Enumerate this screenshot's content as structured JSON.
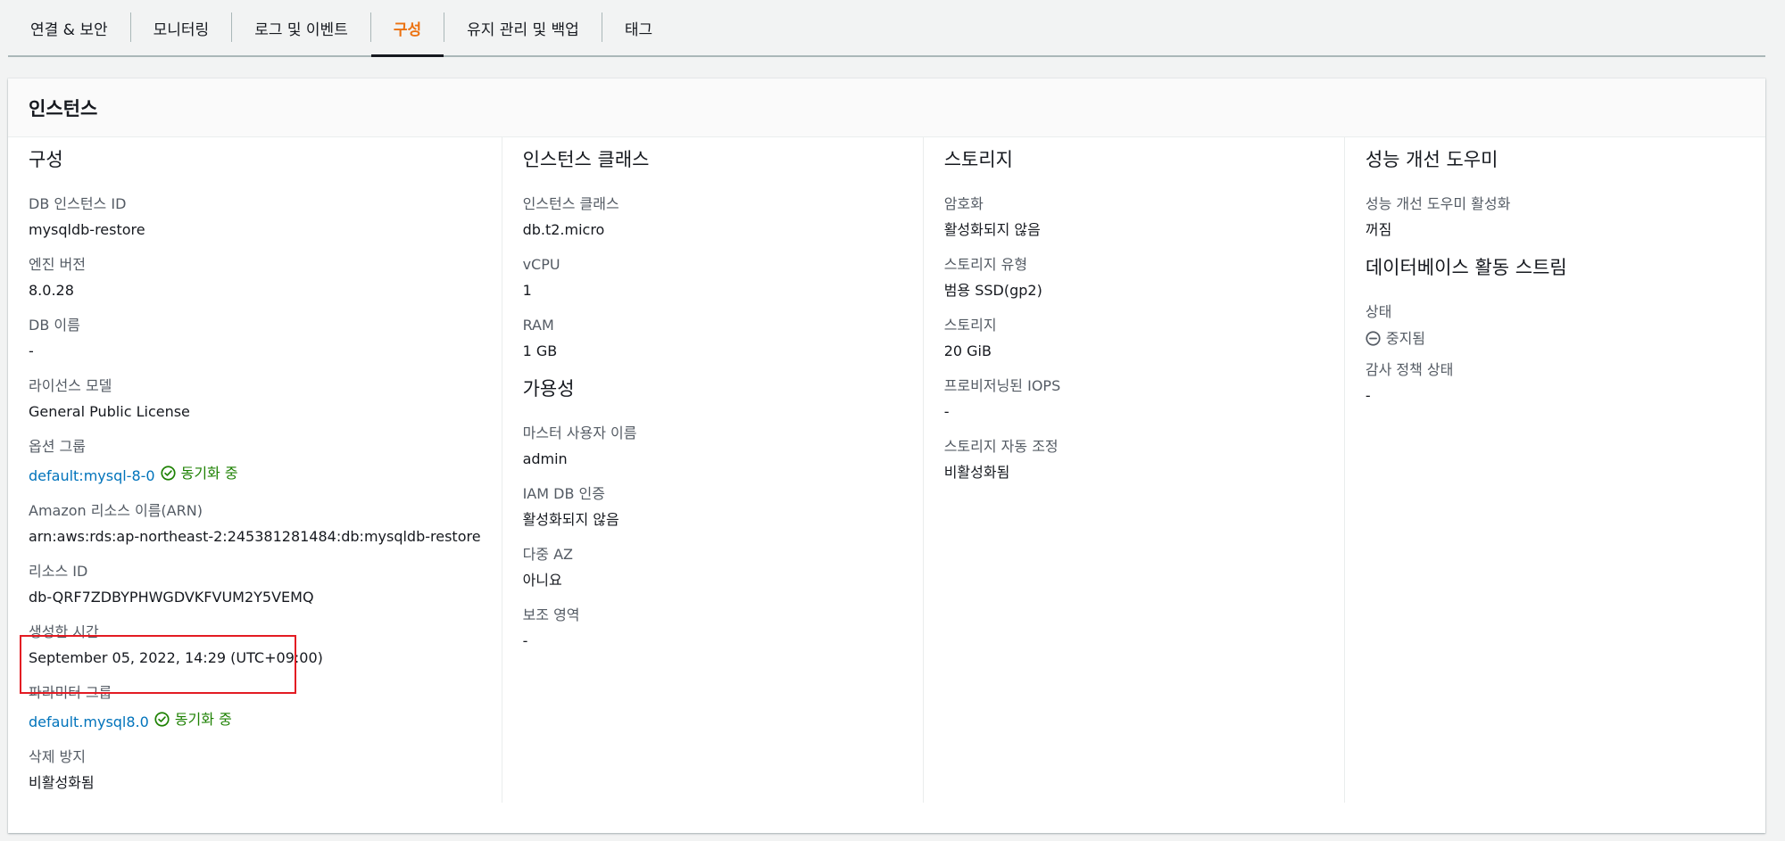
{
  "tabs": [
    {
      "label": "연결 & 보안",
      "active": false
    },
    {
      "label": "모니터링",
      "active": false
    },
    {
      "label": "로그 및 이벤트",
      "active": false
    },
    {
      "label": "구성",
      "active": true
    },
    {
      "label": "유지 관리 및 백업",
      "active": false
    },
    {
      "label": "태그",
      "active": false
    }
  ],
  "panel": {
    "title": "인스턴스"
  },
  "config": {
    "title": "구성",
    "db_instance_id": {
      "label": "DB 인스턴스 ID",
      "value": "mysqldb-restore"
    },
    "engine_version": {
      "label": "엔진 버전",
      "value": "8.0.28"
    },
    "db_name": {
      "label": "DB 이름",
      "value": "-"
    },
    "license_model": {
      "label": "라이선스 모델",
      "value": "General Public License"
    },
    "option_group": {
      "label": "옵션 그룹",
      "value": "default:mysql-8-0",
      "status": "동기화 중"
    },
    "arn": {
      "label": "Amazon 리소스 이름(ARN)",
      "value": "arn:aws:rds:ap-northeast-2:245381281484:db:mysqldb-restore"
    },
    "resource_id": {
      "label": "리소스 ID",
      "value": "db-QRF7ZDBYPHWGDVKFVUM2Y5VEMQ"
    },
    "created_time": {
      "label": "생성한 시간",
      "value": "September 05, 2022, 14:29 (UTC+09:00)"
    },
    "parameter_group": {
      "label": "파라미터 그룹",
      "value": "default.mysql8.0",
      "status": "동기화 중"
    },
    "deletion_protection": {
      "label": "삭제 방지",
      "value": "비활성화됨"
    }
  },
  "instance_class": {
    "title": "인스턴스 클래스",
    "class": {
      "label": "인스턴스 클래스",
      "value": "db.t2.micro"
    },
    "vcpu": {
      "label": "vCPU",
      "value": "1"
    },
    "ram": {
      "label": "RAM",
      "value": "1 GB"
    }
  },
  "availability": {
    "title": "가용성",
    "master_user": {
      "label": "마스터 사용자 이름",
      "value": "admin"
    },
    "iam_auth": {
      "label": "IAM DB 인증",
      "value": "활성화되지 않음"
    },
    "multi_az": {
      "label": "다중 AZ",
      "value": "아니요"
    },
    "secondary_zone": {
      "label": "보조 영역",
      "value": "-"
    }
  },
  "storage": {
    "title": "스토리지",
    "encryption": {
      "label": "암호화",
      "value": "활성화되지 않음"
    },
    "storage_type": {
      "label": "스토리지 유형",
      "value": "범용 SSD(gp2)"
    },
    "storage": {
      "label": "스토리지",
      "value": "20 GiB"
    },
    "provisioned_iops": {
      "label": "프로비저닝된 IOPS",
      "value": "-"
    },
    "autoscaling": {
      "label": "스토리지 자동 조정",
      "value": "비활성화됨"
    }
  },
  "performance_insights": {
    "title": "성능 개선 도우미",
    "enabled": {
      "label": "성능 개선 도우미 활성화",
      "value": "꺼짐"
    }
  },
  "activity_stream": {
    "title": "데이터베이스 활동 스트림",
    "status": {
      "label": "상태",
      "value": "중지됨"
    },
    "audit_policy": {
      "label": "감사 정책 상태",
      "value": "-"
    }
  },
  "colors": {
    "accent_tab": "#ec7211",
    "link": "#0073bb",
    "success": "#1d8102",
    "highlight": "#e31b23"
  }
}
